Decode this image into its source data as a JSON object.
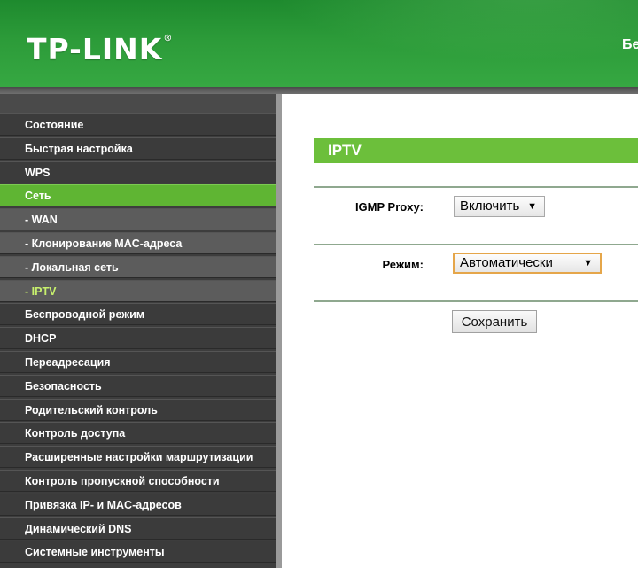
{
  "header": {
    "logo_text": "TP-LINK",
    "logo_mark": "®",
    "right_text": "Бе"
  },
  "sidebar": {
    "items": [
      {
        "label": "Состояние"
      },
      {
        "label": "Быстрая настройка"
      },
      {
        "label": "WPS"
      },
      {
        "label": "Сеть"
      },
      {
        "label": "- WAN"
      },
      {
        "label": "- Клонирование MAC-адреса"
      },
      {
        "label": "- Локальная сеть"
      },
      {
        "label": "- IPTV"
      },
      {
        "label": "Беспроводной режим"
      },
      {
        "label": "DHCP"
      },
      {
        "label": "Переадресация"
      },
      {
        "label": "Безопасность"
      },
      {
        "label": "Родительский контроль"
      },
      {
        "label": "Контроль доступа"
      },
      {
        "label": "Расширенные настройки маршрутизации"
      },
      {
        "label": "Контроль пропускной способности"
      },
      {
        "label": "Привязка IP- и MAC-адресов"
      },
      {
        "label": "Динамический DNS"
      },
      {
        "label": "Системные инструменты"
      }
    ]
  },
  "content": {
    "title": "IPTV",
    "igmp_label": "IGMP Proxy:",
    "igmp_value": "Включить",
    "mode_label": "Режим:",
    "mode_value": "Автоматически",
    "save_label": "Сохранить"
  },
  "colors": {
    "header_green": "#2c9b39",
    "active_green": "#5fb533",
    "title_green": "#6cbf3b",
    "current_sub_text": "#c7f06d"
  }
}
